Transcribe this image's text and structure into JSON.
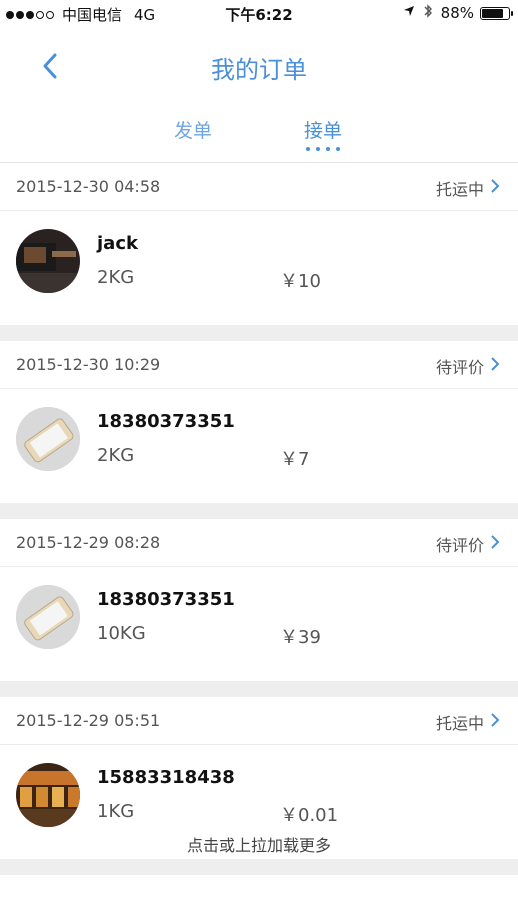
{
  "status_bar": {
    "carrier": "中国电信",
    "network": "4G",
    "time": "下午6:22",
    "battery_text": "88%",
    "battery_level": 0.88,
    "signal_bars": 3
  },
  "nav": {
    "title": "我的订单",
    "back_icon": "chevron-left-icon"
  },
  "tabs": [
    {
      "label": "发单",
      "active": false
    },
    {
      "label": "接单",
      "active": true
    }
  ],
  "orders": [
    {
      "time": "2015-12-30 04:58",
      "status": "托运中",
      "name": "jack",
      "weight": "2KG",
      "price": "￥10",
      "avatar": "dark-device-photo"
    },
    {
      "time": "2015-12-30 10:29",
      "status": "待评价",
      "name": "18380373351",
      "weight": "2KG",
      "price": "￥7",
      "avatar": "phone-photo"
    },
    {
      "time": "2015-12-29 08:28",
      "status": "待评价",
      "name": "18380373351",
      "weight": "10KG",
      "price": "￥39",
      "avatar": "phone-photo"
    },
    {
      "time": "2015-12-29 05:51",
      "status": "托运中",
      "name": "15883318438",
      "weight": "1KG",
      "price": "￥0.01",
      "avatar": "shop-photo"
    }
  ],
  "load_more": "点击或上拉加载更多",
  "colors": {
    "accent": "#4a90d9",
    "tab_inactive": "#6ea6e2",
    "gap": "#eeeeee",
    "text_secondary": "#555555"
  }
}
